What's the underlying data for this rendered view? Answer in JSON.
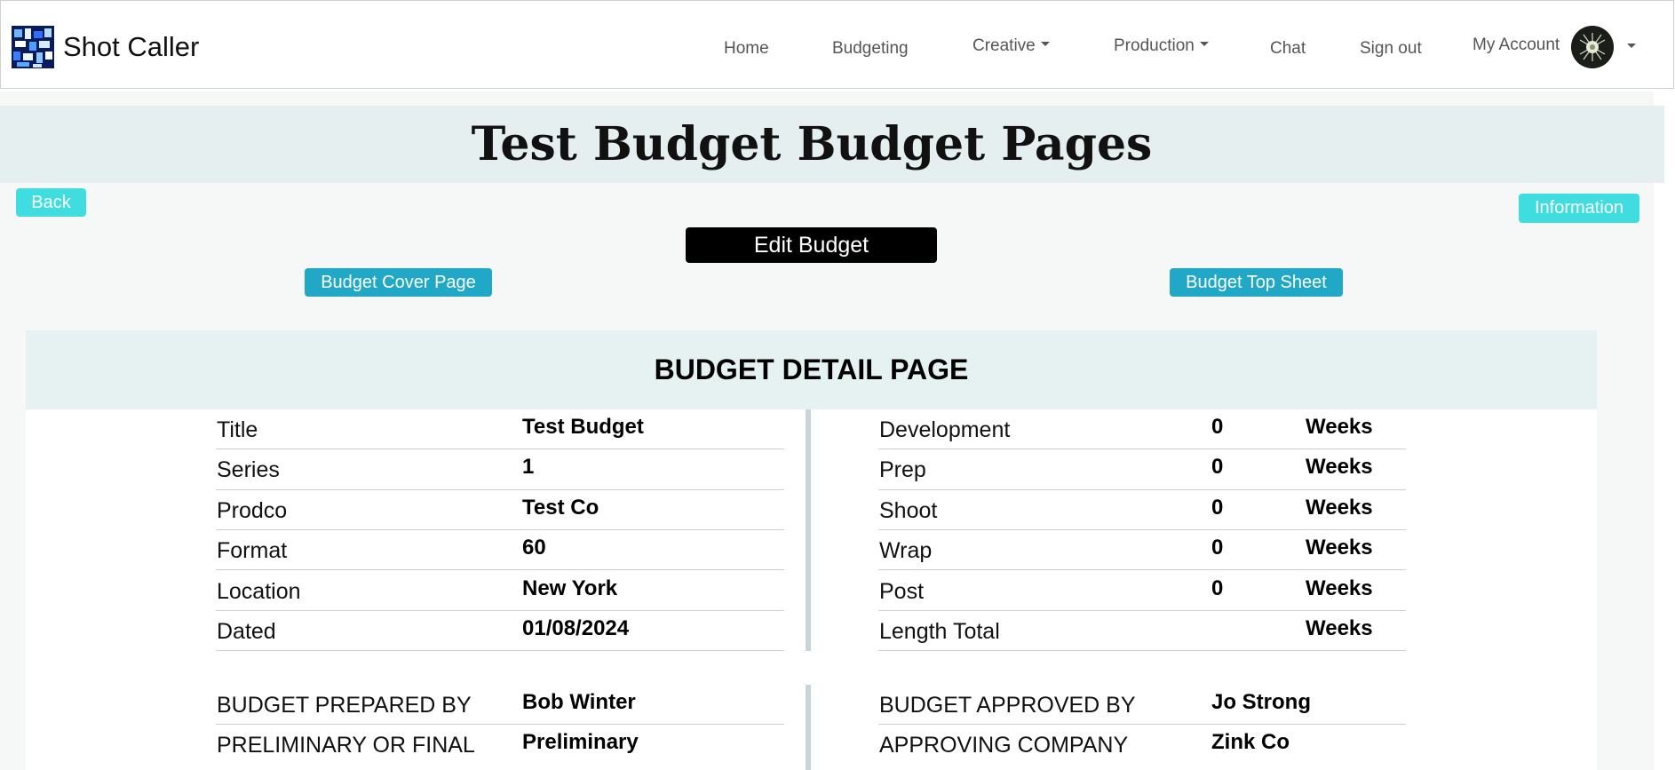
{
  "navbar": {
    "brand": "Shot Caller",
    "links": {
      "home": "Home",
      "budgeting": "Budgeting",
      "creative": "Creative",
      "production": "Production",
      "chat": "Chat",
      "signout": "Sign out",
      "account": "My Account"
    }
  },
  "page": {
    "title": "Test Budget Budget Pages",
    "back": "Back",
    "information": "Information",
    "edit_budget": "Edit Budget",
    "cover_page": "Budget Cover Page",
    "top_sheet": "Budget Top Sheet"
  },
  "detail": {
    "heading": "BUDGET DETAIL PAGE",
    "left_rows": [
      {
        "label": "Title",
        "value": "Test Budget"
      },
      {
        "label": "Series",
        "value": "1"
      },
      {
        "label": "Prodco",
        "value": "Test Co"
      },
      {
        "label": "Format",
        "value": "60"
      },
      {
        "label": "Location",
        "value": "New York"
      },
      {
        "label": "Dated",
        "value": "01/08/2024"
      }
    ],
    "right_rows": [
      {
        "label": "Development",
        "value": "0",
        "unit": "Weeks"
      },
      {
        "label": "Prep",
        "value": "0",
        "unit": "Weeks"
      },
      {
        "label": "Shoot",
        "value": "0",
        "unit": "Weeks"
      },
      {
        "label": "Wrap",
        "value": "0",
        "unit": "Weeks"
      },
      {
        "label": "Post",
        "value": "0",
        "unit": "Weeks"
      },
      {
        "label": "Length Total",
        "value": "",
        "unit": "Weeks"
      }
    ],
    "left_bottom": [
      {
        "label": "BUDGET PREPARED BY",
        "value": "Bob Winter"
      },
      {
        "label": "PRELIMINARY OR FINAL",
        "value": "Preliminary"
      }
    ],
    "right_bottom": [
      {
        "label": "BUDGET APPROVED BY",
        "value": "Jo Strong"
      },
      {
        "label": "APPROVING COMPANY",
        "value": "Zink Co"
      }
    ]
  }
}
